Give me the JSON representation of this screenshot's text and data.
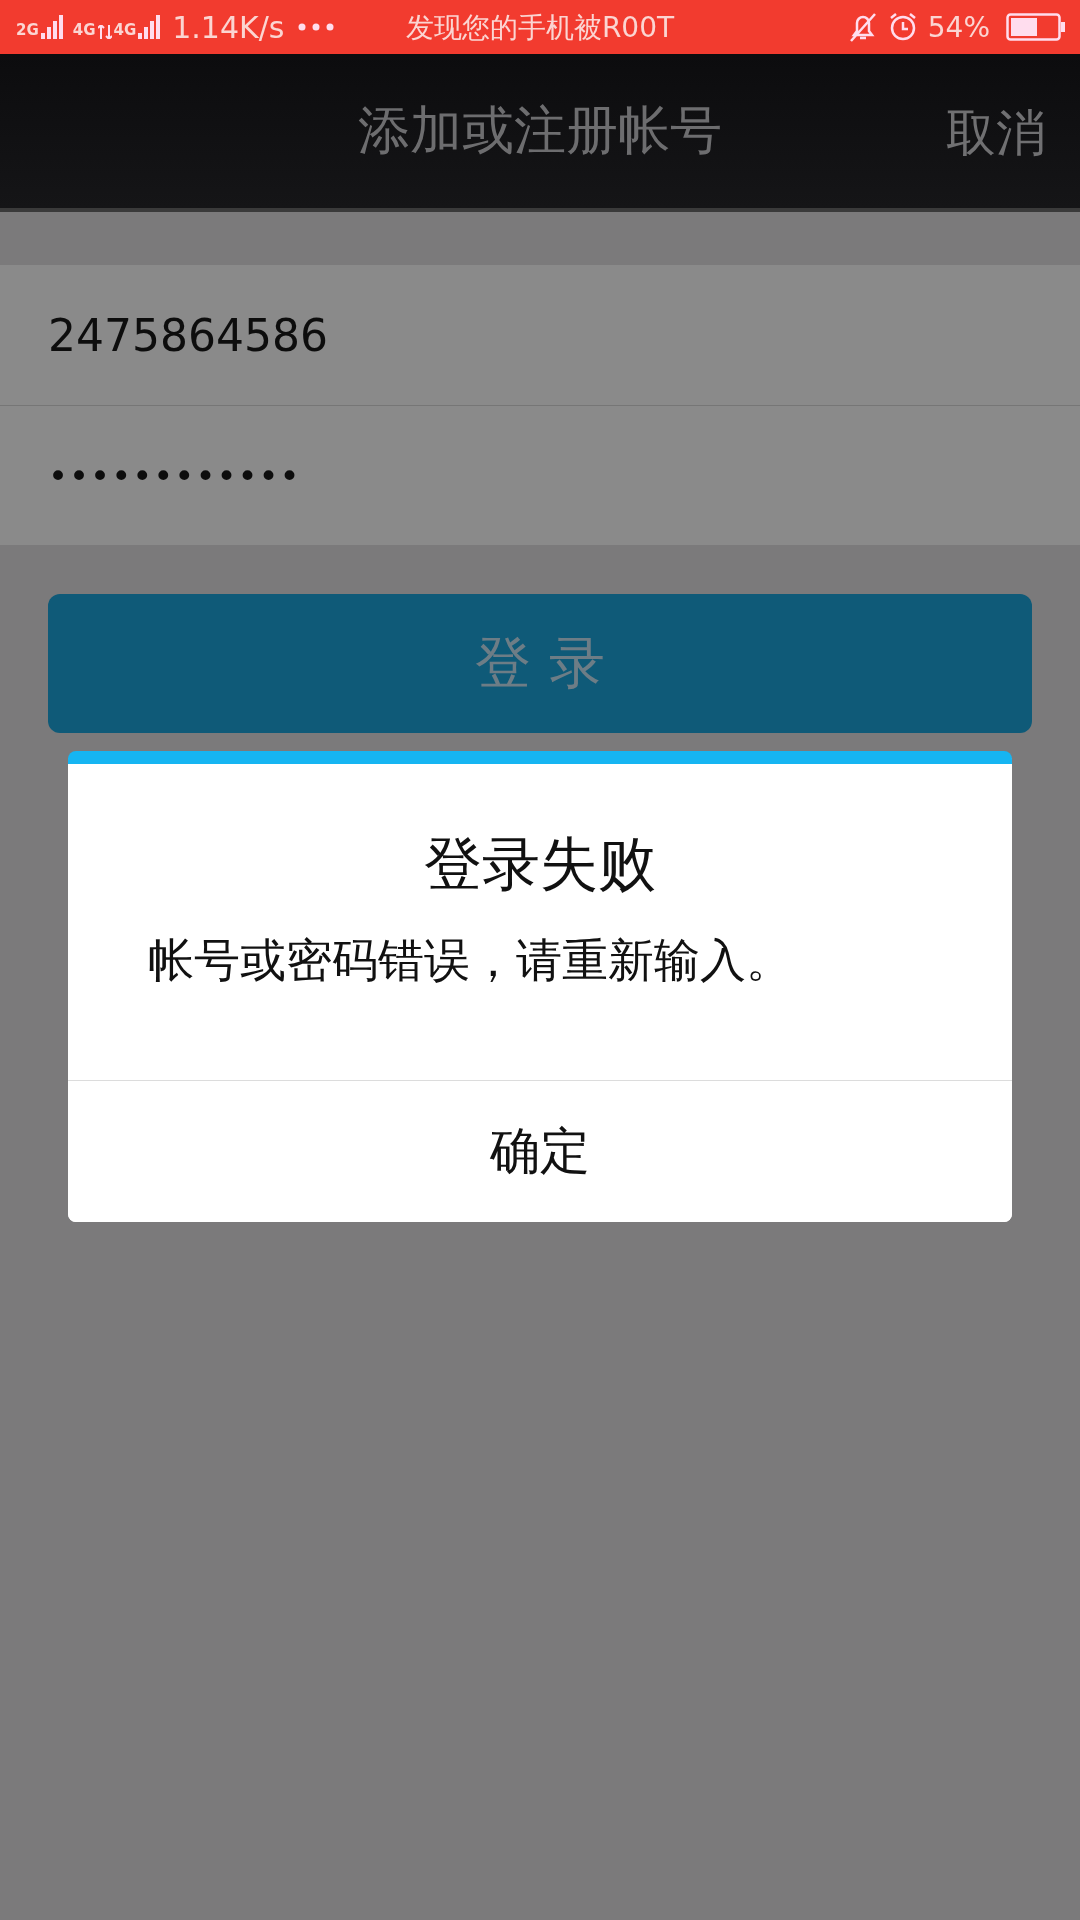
{
  "status_bar": {
    "network_labels": [
      "2G",
      "4G",
      "4G"
    ],
    "speed": "1.14K/s",
    "notification": "发现您的手机被R00T",
    "battery": "54%"
  },
  "header": {
    "title": "添加或注册帐号",
    "cancel": "取消"
  },
  "form": {
    "account": {
      "value": "2475864586"
    },
    "password": {
      "value": "••••••••••••"
    },
    "login_button": "登 录"
  },
  "dialog": {
    "title": "登录失败",
    "message": "帐号或密码错误，请重新输入。",
    "button": "确定"
  }
}
